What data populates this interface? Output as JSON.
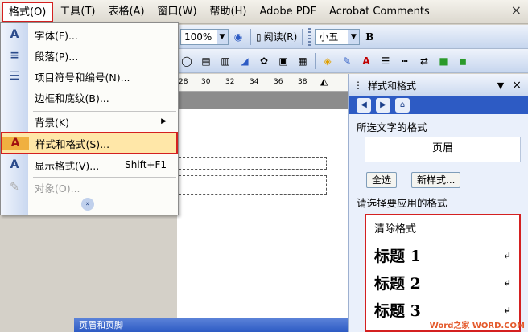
{
  "menubar": {
    "items": [
      "格式(O)",
      "工具(T)",
      "表格(A)",
      "窗口(W)",
      "帮助(H)",
      "Adobe PDF",
      "Acrobat Comments"
    ],
    "close": "×"
  },
  "toolbar1": {
    "zoom": "100%",
    "read_label": "阅读(R)",
    "font_size": "小五",
    "bold": "B"
  },
  "ruler": {
    "ticks": [
      "28",
      "30",
      "32",
      "34",
      "36",
      "38"
    ]
  },
  "format_menu": {
    "items": [
      {
        "label": "字体(F)...",
        "icon": "A"
      },
      {
        "label": "段落(P)...",
        "icon": "≡"
      },
      {
        "label": "项目符号和编号(N)...",
        "icon": "☰"
      },
      {
        "label": "边框和底纹(B)...",
        "icon": ""
      },
      {
        "label": "背景(K)",
        "icon": "",
        "arrow": "▶"
      },
      {
        "label": "样式和格式(S)...",
        "icon": "A"
      },
      {
        "label": "显示格式(V)...",
        "icon": "A",
        "shortcut": "Shift+F1"
      },
      {
        "label": "对象(O)...",
        "icon": "✎"
      }
    ],
    "expand": "»"
  },
  "taskpane": {
    "title": "样式和格式",
    "selected_label": "所选文字的格式",
    "selected_value": "页眉",
    "select_all": "全选",
    "new_style": "新样式...",
    "apply_label": "请选择要应用的格式",
    "styles": [
      {
        "name": "清除格式",
        "ret": ""
      },
      {
        "name": "标题 1",
        "ret": "↵"
      },
      {
        "name": "标题 2",
        "ret": "↵"
      },
      {
        "name": "标题 3",
        "ret": "↵"
      }
    ]
  },
  "dialog": {
    "title": "页眉和页脚"
  },
  "colors": {
    "highlight": "#ffe7a8",
    "annotation_red": "#d42020",
    "office_blue": "#2d5bc4"
  },
  "watermark": "Word之家 WORD.COM"
}
